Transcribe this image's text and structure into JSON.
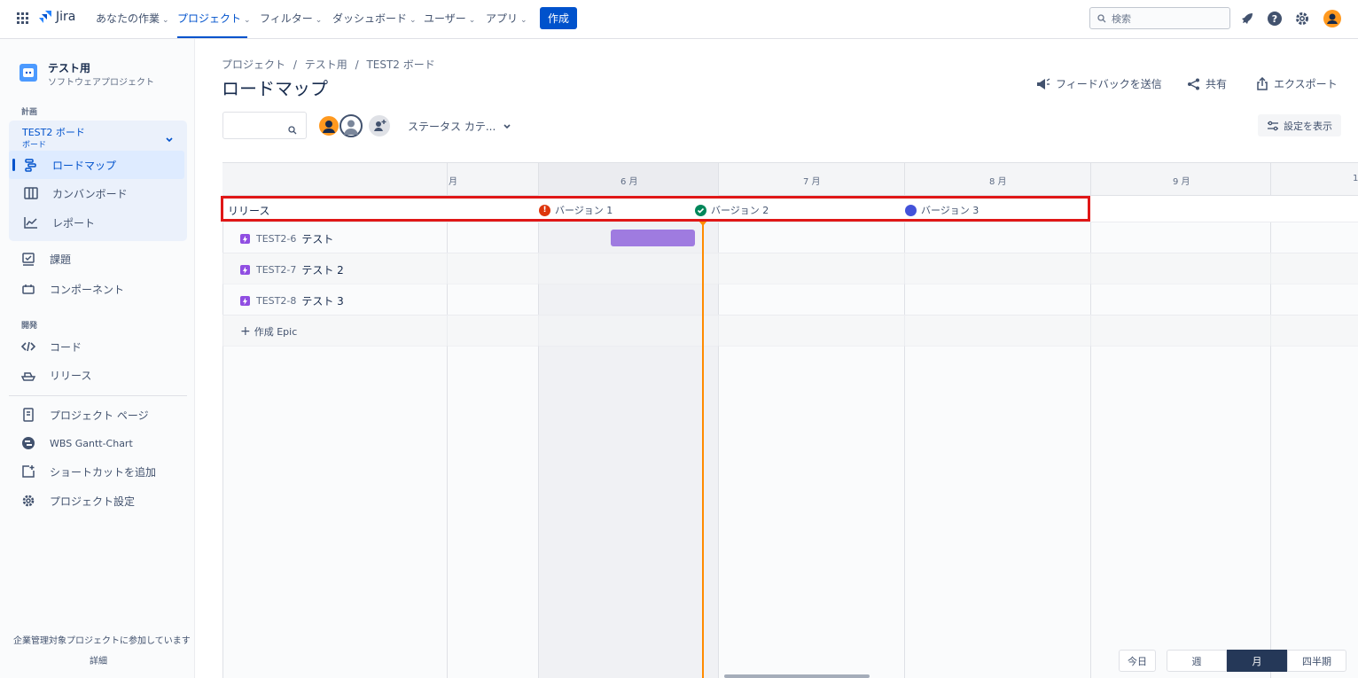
{
  "topnav": {
    "product": "Jira",
    "items": [
      {
        "label": "あなたの作業"
      },
      {
        "label": "プロジェクト"
      },
      {
        "label": "フィルター"
      },
      {
        "label": "ダッシュボード"
      },
      {
        "label": "ユーザー"
      },
      {
        "label": "アプリ"
      }
    ],
    "create_label": "作成",
    "search_placeholder": "検索"
  },
  "sidebar": {
    "project_name": "テスト用",
    "project_type": "ソフトウェアプロジェクト",
    "section_plan": "計画",
    "board_name": "TEST2 ボード",
    "board_type": "ボード",
    "items": [
      {
        "label": "ロードマップ"
      },
      {
        "label": "カンバンボード"
      },
      {
        "label": "レポート"
      },
      {
        "label": "課題"
      },
      {
        "label": "コンポーネント"
      }
    ],
    "section_dev": "開発",
    "dev_items": [
      {
        "label": "コード"
      },
      {
        "label": "リリース"
      }
    ],
    "other_items": [
      {
        "label": "プロジェクト ページ"
      },
      {
        "label": "WBS Gantt-Chart"
      },
      {
        "label": "ショートカットを追加"
      },
      {
        "label": "プロジェクト設定"
      }
    ],
    "footer_text": "企業管理対象プロジェクトに参加しています",
    "footer_link": "詳細"
  },
  "main": {
    "breadcrumb": [
      "プロジェクト",
      "テスト用",
      "TEST2 ボード"
    ],
    "title": "ロードマップ",
    "actions": {
      "feedback": "フィードバックを送信",
      "share": "共有",
      "export": "エクスポート"
    },
    "status_filter": "ステータス カテ...",
    "settings_label": "設定を表示"
  },
  "timeline": {
    "months": [
      "月",
      "6 月",
      "7 月",
      "8 月",
      "9 月",
      "1"
    ],
    "release_row_label": "リリース",
    "versions": [
      {
        "label": "バージョン 1",
        "status": "warning",
        "color": "#de350b"
      },
      {
        "label": "バージョン 2",
        "status": "released",
        "color": "#00875a"
      },
      {
        "label": "バージョン 3",
        "status": "unreleased",
        "color": "#4352d9"
      }
    ],
    "epics": [
      {
        "key": "TEST2-6",
        "name": "テスト"
      },
      {
        "key": "TEST2-7",
        "name": "テスト 2"
      },
      {
        "key": "TEST2-8",
        "name": "テスト 3"
      }
    ],
    "create_epic": "作成 Epic"
  },
  "zoom": {
    "today": "今日",
    "week": "週",
    "month": "月",
    "quarter": "四半期",
    "selected": "月"
  },
  "colors": {
    "accent": "#0052cc",
    "today_line": "#ff8b00",
    "epic_bar": "#9f7be0",
    "highlight": "#e01717"
  }
}
